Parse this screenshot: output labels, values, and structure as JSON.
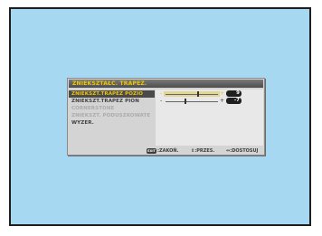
{
  "menu": {
    "title": "ZNIEKSZTAŁC. TRAPEZ.",
    "items": [
      {
        "label": "ZNIEKSZT.TRAPEZ POZIO",
        "state": "selected"
      },
      {
        "label": "ZNIEKSZT.TRAPEZ PION",
        "state": "normal"
      },
      {
        "label": "CORNERSTONE",
        "state": "disabled"
      },
      {
        "label": "ZNIEKSZT. PODUSZKOWATE",
        "state": "disabled"
      },
      {
        "label": "WYZER.",
        "state": "normal"
      }
    ],
    "sliders": [
      {
        "minus": "-",
        "plus": "+",
        "value": "9",
        "level": 0.62
      },
      {
        "minus": "-",
        "plus": "+",
        "value": "-7",
        "level": 0.38
      }
    ]
  },
  "footer": {
    "exit_key": "EXIT",
    "exit_label": ":ZAKOŃ.",
    "select": "⇕:PRZES.",
    "adjust": "⇔:DOSTOSUJ"
  },
  "colors": {
    "screen_bg": "#a7d8f2",
    "highlight": "#f2c500",
    "osd_bg": "#d4d4d4"
  }
}
